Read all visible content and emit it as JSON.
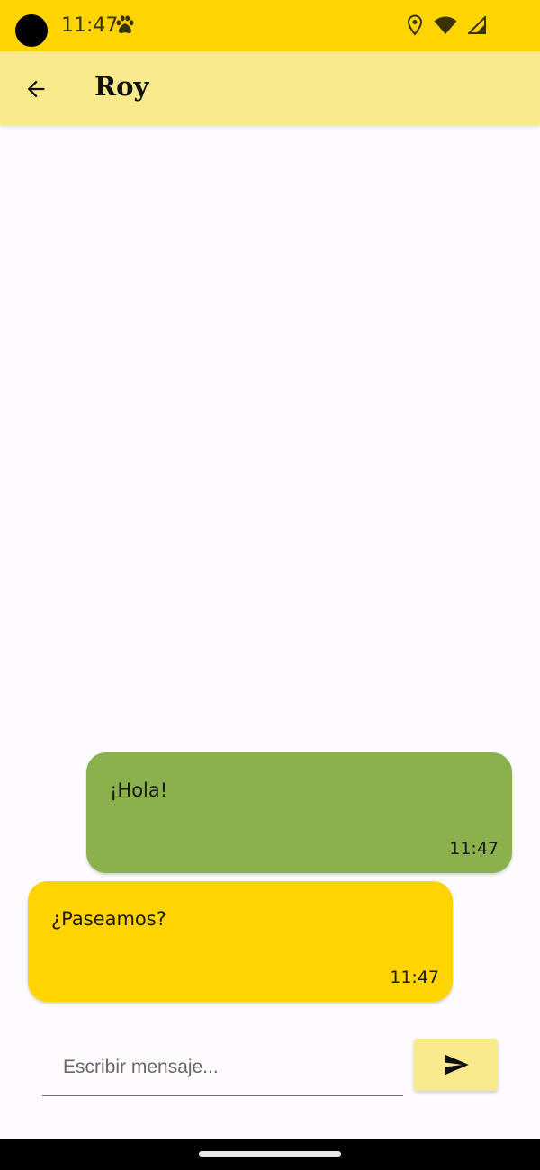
{
  "status_bar": {
    "time": "11:47",
    "icons": [
      "paw-icon",
      "location-icon",
      "wifi-icon",
      "signal-icon"
    ],
    "background": "#ffd400"
  },
  "app_bar": {
    "title": "Roy",
    "back_icon": "arrow-left-icon",
    "background": "#f8e98c"
  },
  "messages": [
    {
      "direction": "sent",
      "text": "¡Hola!",
      "time": "11:47",
      "color": "#8bb14d"
    },
    {
      "direction": "received",
      "text": "¿Paseamos?",
      "time": "11:47",
      "color": "#ffd400"
    }
  ],
  "composer": {
    "placeholder": "Escribir mensaje...",
    "value": "",
    "send_icon": "send-icon"
  }
}
